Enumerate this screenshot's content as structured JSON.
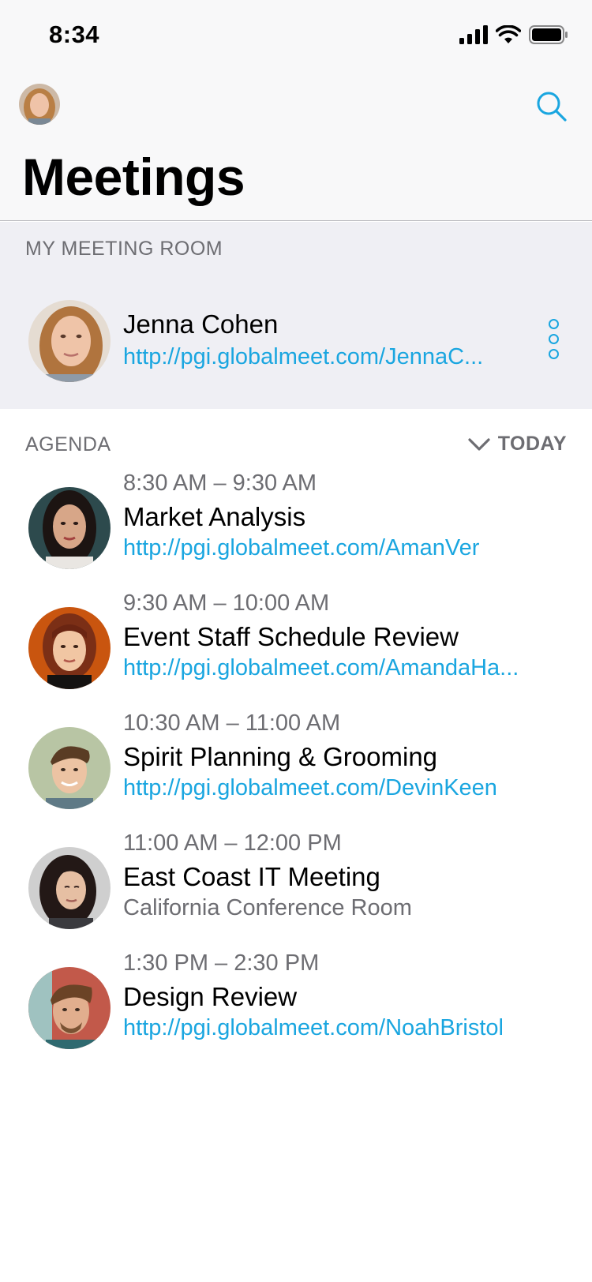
{
  "status_bar": {
    "time": "8:34"
  },
  "header": {
    "title": "Meetings",
    "search_icon": "search-icon"
  },
  "colors": {
    "accent": "#1aa6e0",
    "secondary_text": "#6d6d72",
    "grouped_bg": "#efeff4"
  },
  "my_meeting_room": {
    "section_label": "MY MEETING ROOM",
    "name": "Jenna Cohen",
    "url": "http://pgi.globalmeet.com/JennaC..."
  },
  "agenda": {
    "section_label": "AGENDA",
    "filter_label": "TODAY",
    "items": [
      {
        "time": "8:30 AM – 9:30 AM",
        "title": "Market Analysis",
        "detail": "http://pgi.globalmeet.com/AmanVer"
      },
      {
        "time": "9:30 AM – 10:00 AM",
        "title": "Event Staff Schedule Review",
        "detail": "http://pgi.globalmeet.com/AmandaHa..."
      },
      {
        "time": "10:30 AM – 11:00 AM",
        "title": "Spirit Planning & Grooming",
        "detail": "http://pgi.globalmeet.com/DevinKeen"
      },
      {
        "time": "11:00 AM – 12:00 PM",
        "title": "East Coast IT Meeting",
        "detail": "California Conference Room"
      },
      {
        "time": "1:30 PM – 2:30 PM",
        "title": "Design Review",
        "detail": "http://pgi.globalmeet.com/NoahBristol"
      }
    ]
  }
}
